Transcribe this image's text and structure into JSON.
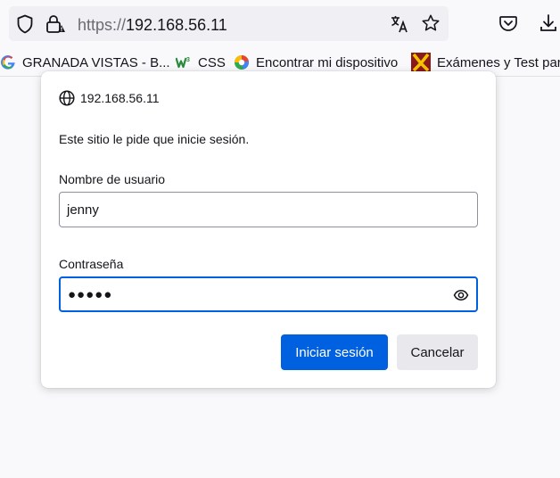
{
  "toolbar": {
    "url_scheme": "https://",
    "url_host": "192.168.56.11",
    "icons": [
      "shield-icon",
      "lock-warning-icon",
      "translate-icon",
      "star-icon",
      "pocket-icon",
      "download-icon"
    ]
  },
  "bookmarks": [
    {
      "label": "GRANADA VISTAS - B...",
      "icon": "google-favicon"
    },
    {
      "label": "CSS",
      "icon": "w3c-favicon"
    },
    {
      "label": "Encontrar mi dispositivo",
      "icon": "find-device-favicon"
    },
    {
      "label": "Exámenes y Test para",
      "icon": "x-favicon"
    }
  ],
  "dialog": {
    "origin": "192.168.56.11",
    "message": "Este sitio le pide que inicie sesión.",
    "username_label": "Nombre de usuario",
    "username_value": "jenny",
    "password_label": "Contraseña",
    "password_mask": "●●●●●",
    "login_button": "Iniciar sesión",
    "cancel_button": "Cancelar"
  },
  "colors": {
    "accent": "#0061e0",
    "secondary_button": "#e9e9ed",
    "urlbar": "#f0f0f4"
  }
}
